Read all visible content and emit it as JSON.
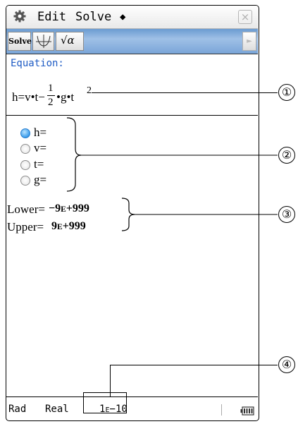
{
  "menubar": {
    "gear_icon": "gear-icon",
    "edit": "Edit",
    "solve": "Solve",
    "diamond": "◆",
    "close": "×"
  },
  "toolbar": {
    "solve_label": "Solve",
    "graph_icon": "graph-icon",
    "sqrt_label": "√α",
    "scroll": "►"
  },
  "equation": {
    "label": "Equation:",
    "lhs": "h=v•t−",
    "frac_num": "1",
    "frac_den": "2",
    "rhs": "•g•t",
    "exp": "2"
  },
  "variables": [
    {
      "label": "h=",
      "selected": true
    },
    {
      "label": "v=",
      "selected": false
    },
    {
      "label": "t=",
      "selected": false
    },
    {
      "label": "g=",
      "selected": false
    }
  ],
  "bounds": {
    "lower_label": "Lower=",
    "lower_value": "−9E+999",
    "upper_label": "Upper=",
    "upper_value": "9E+999"
  },
  "status": {
    "angle": "Rad",
    "mode": "Real",
    "tolerance": "1E−10",
    "battery_icon": "battery-icon"
  },
  "callouts": [
    "①",
    "②",
    "③",
    "④"
  ],
  "colors": {
    "accent": "#1e5bc4",
    "radio_on": "#43a1ec",
    "toolbar": "#7aa5d8"
  }
}
